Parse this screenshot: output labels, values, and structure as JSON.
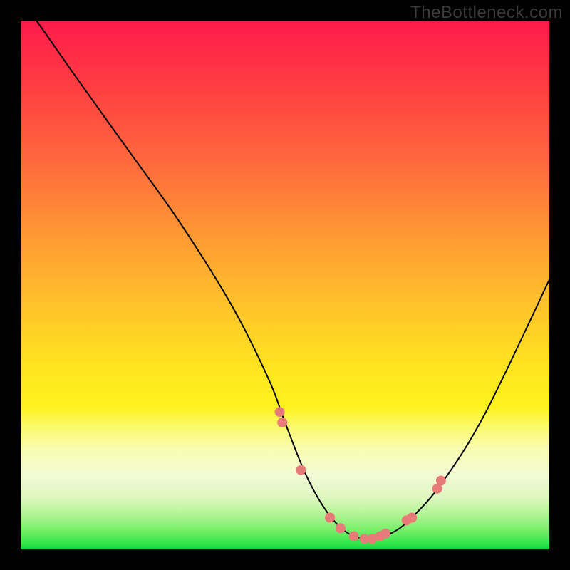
{
  "watermark": "TheBottleneck.com",
  "chart_data": {
    "type": "line",
    "title": "",
    "xlabel": "",
    "ylabel": "",
    "xlim": [
      0,
      100
    ],
    "ylim": [
      0,
      100
    ],
    "series": [
      {
        "name": "curve",
        "x": [
          3,
          10,
          20,
          30,
          40,
          47,
          50,
          54,
          58,
          62,
          66,
          70,
          74,
          80,
          88,
          100
        ],
        "y": [
          100,
          90,
          76,
          62,
          46,
          32,
          24,
          14,
          7,
          3,
          2,
          3,
          6,
          13,
          26,
          51
        ]
      }
    ],
    "markers": {
      "name": "dots",
      "color": "#e77b78",
      "x": [
        49.0,
        49.5,
        53.0,
        58.5,
        60.5,
        63.0,
        65.0,
        66.5,
        68.0,
        69.0,
        73.0,
        74.0,
        78.8,
        79.5
      ],
      "y": [
        26.0,
        24.0,
        15.0,
        6.0,
        4.0,
        2.5,
        2.0,
        2.0,
        2.5,
        3.0,
        5.5,
        6.0,
        11.5,
        13.0
      ]
    },
    "gradient_stops": [
      {
        "pos": 0,
        "color": "#ff1a4b"
      },
      {
        "pos": 13,
        "color": "#ff3f42"
      },
      {
        "pos": 27,
        "color": "#ff6a3d"
      },
      {
        "pos": 41,
        "color": "#ff9a33"
      },
      {
        "pos": 55,
        "color": "#ffc62a"
      },
      {
        "pos": 66,
        "color": "#ffe51f"
      },
      {
        "pos": 73,
        "color": "#fdf21e"
      },
      {
        "pos": 77,
        "color": "#fbfa6e"
      },
      {
        "pos": 81,
        "color": "#f9fcb0"
      },
      {
        "pos": 86,
        "color": "#f2fad6"
      },
      {
        "pos": 90,
        "color": "#dff7c1"
      },
      {
        "pos": 93,
        "color": "#b8f59a"
      },
      {
        "pos": 96,
        "color": "#7ff06e"
      },
      {
        "pos": 99,
        "color": "#2fe64a"
      },
      {
        "pos": 100,
        "color": "#1ad43e"
      }
    ]
  }
}
